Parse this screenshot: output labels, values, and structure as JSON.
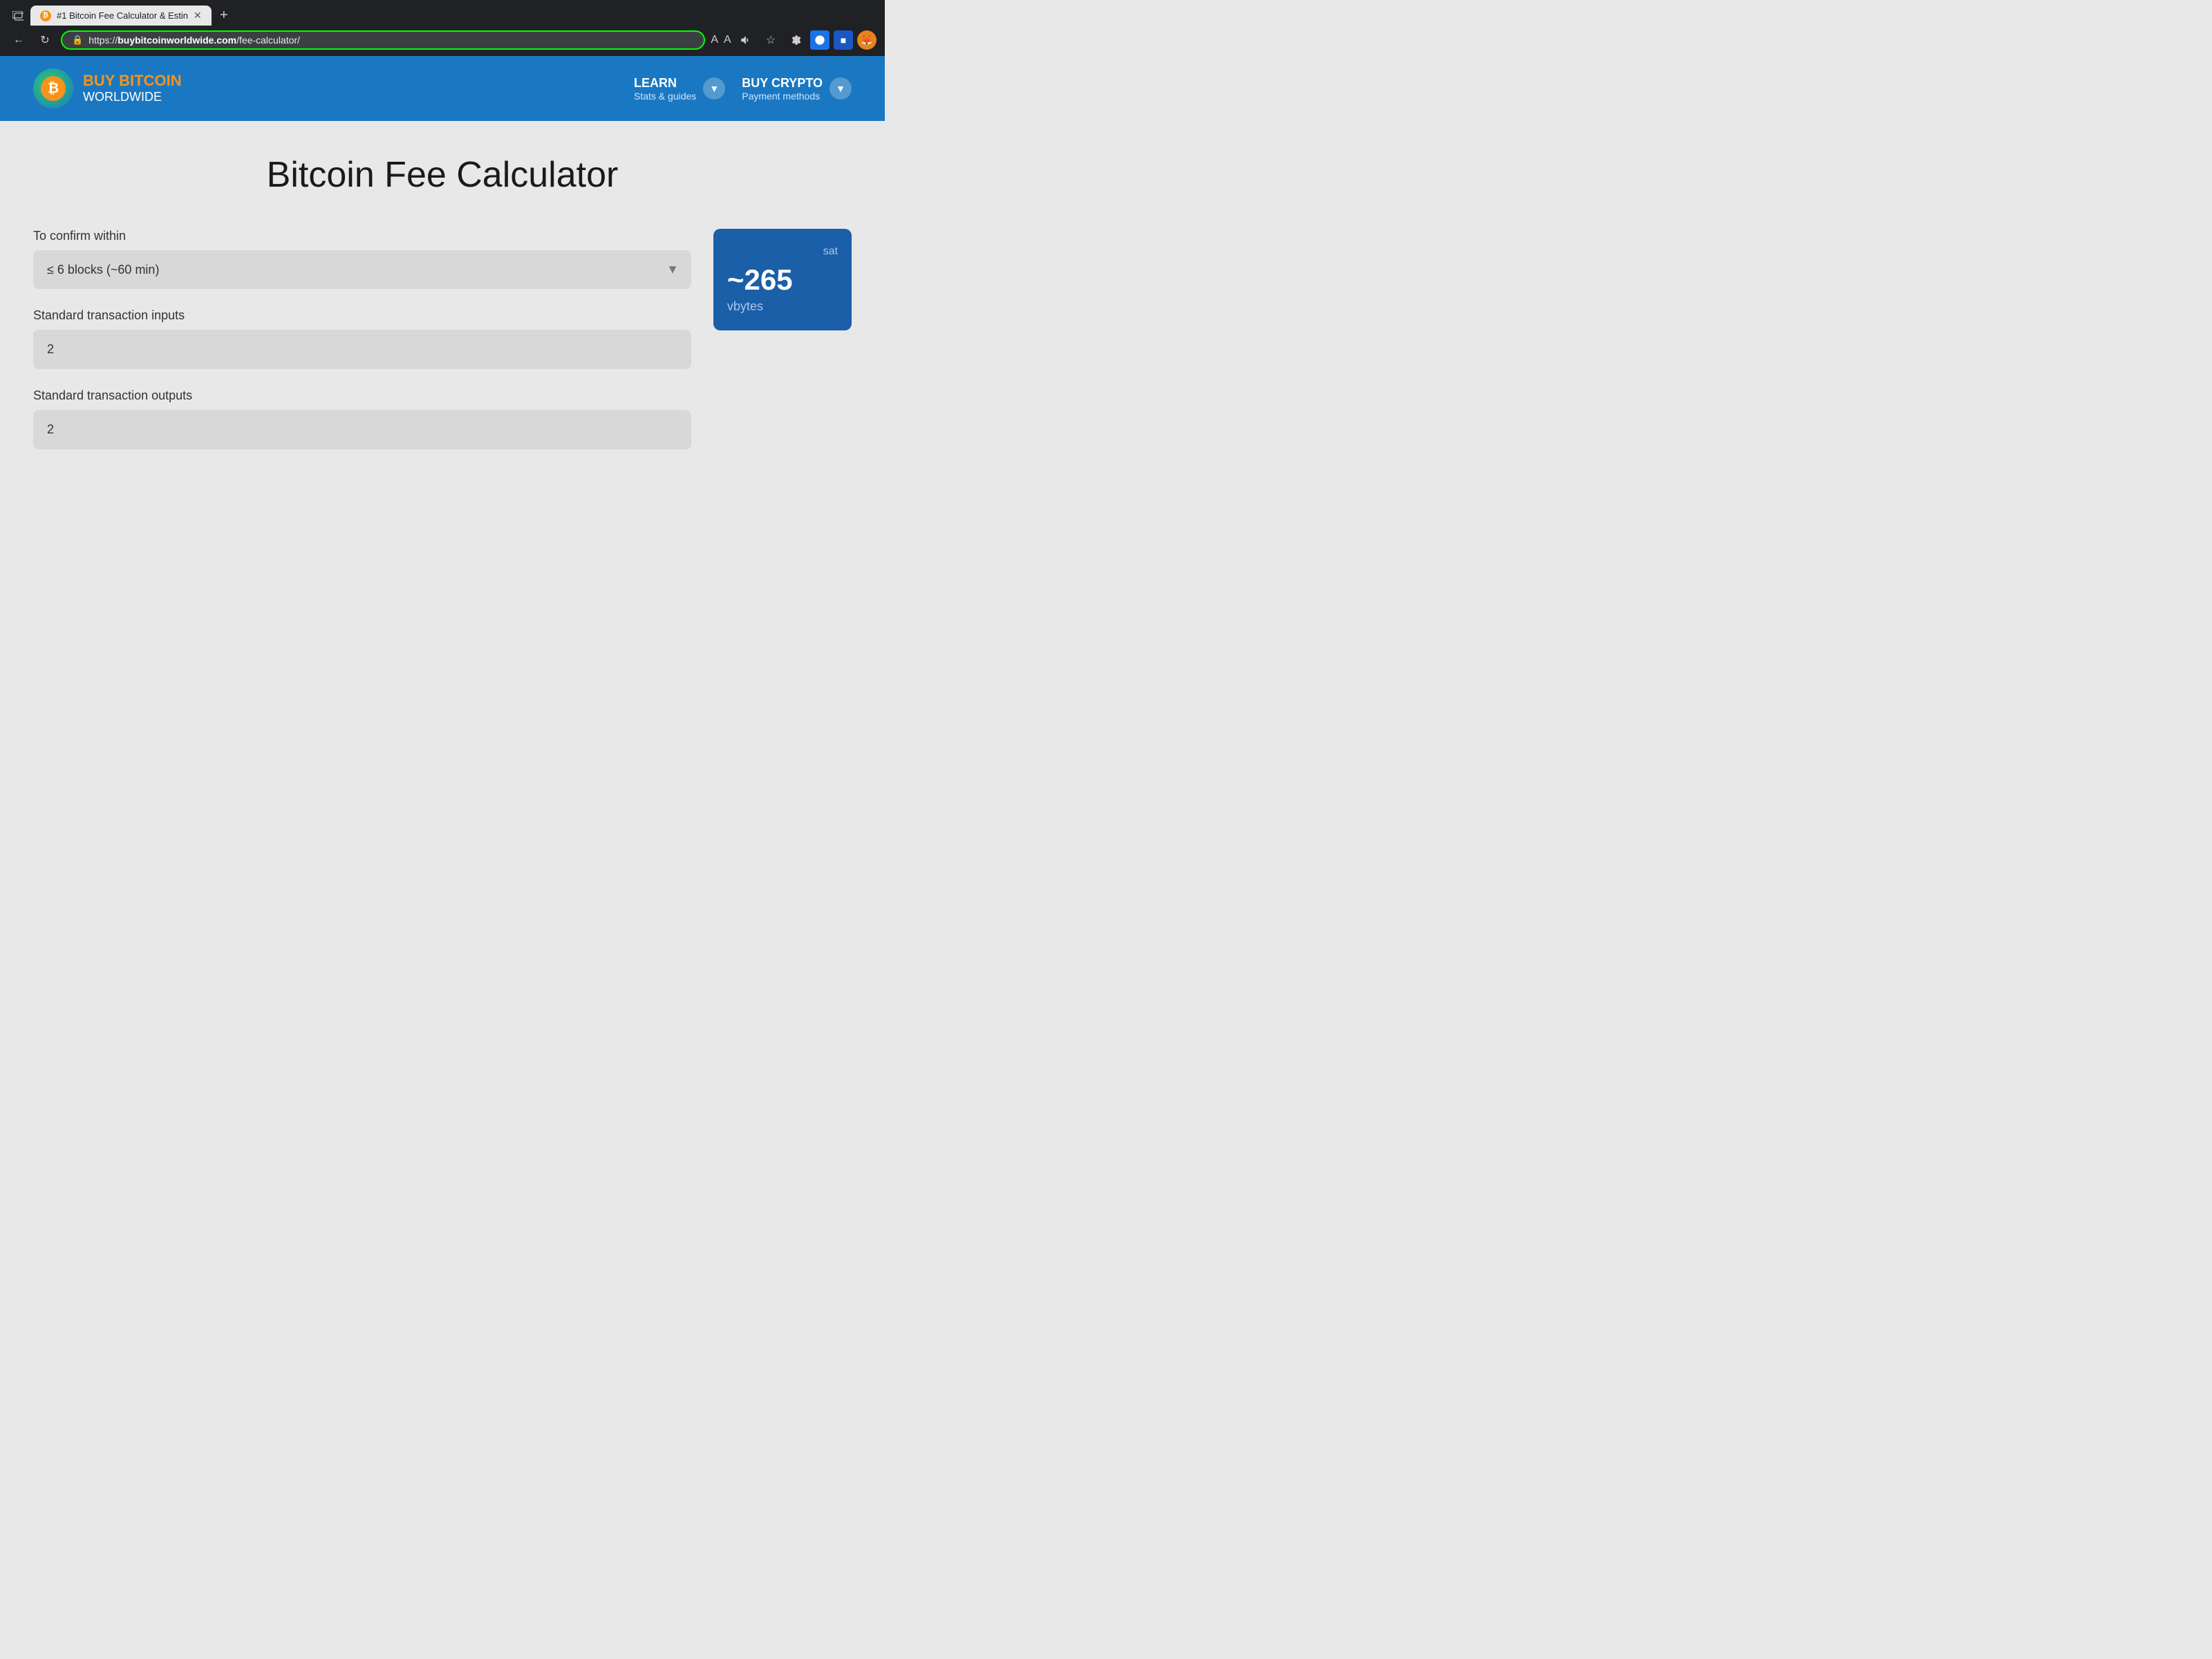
{
  "browser": {
    "tab_title": "#1 Bitcoin Fee Calculator & Estin",
    "tab_favicon": "₿",
    "address": "https://buybitcoinworldwide.com/fee-calculator/",
    "address_prefix": "https://",
    "address_domain": "buybitcoinworldwide.com",
    "address_path": "/fee-calculator/"
  },
  "nav": {
    "logo_buy": "BUY BITCOIN",
    "logo_worldwide": "WORLDWIDE",
    "logo_btc": "₿",
    "learn_label": "LEARN",
    "learn_sub": "Stats & guides",
    "buy_crypto_label": "BUY CRYPTO",
    "buy_crypto_sub": "Payment methods"
  },
  "page": {
    "title": "Bitcoin Fee Calculator",
    "confirm_label": "To confirm within",
    "confirm_value": "≤ 6 blocks (~60 min)",
    "inputs_label": "Standard transaction inputs",
    "inputs_value": "2",
    "outputs_label": "Standard transaction outputs",
    "outputs_value": "2"
  },
  "result": {
    "unit_label": "sat",
    "value": "~265",
    "unit": "vbytes"
  }
}
